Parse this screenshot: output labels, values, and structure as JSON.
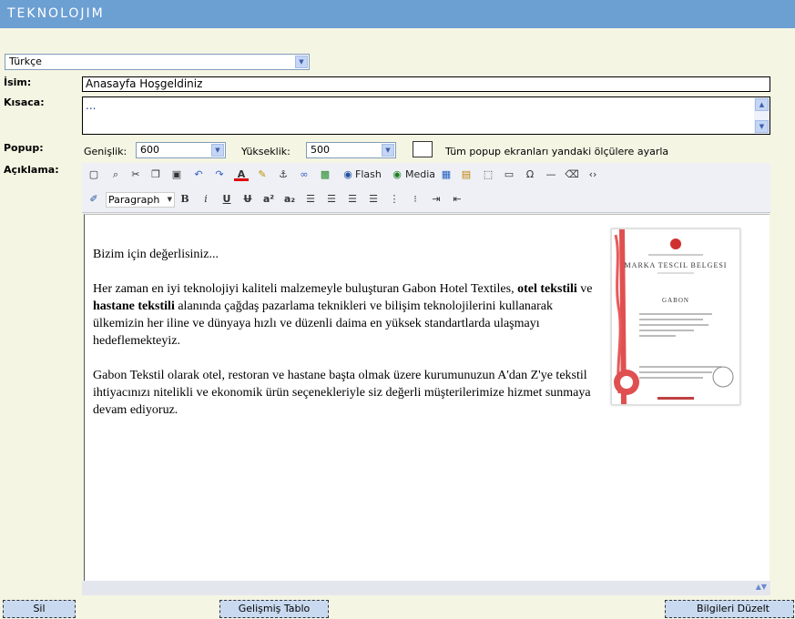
{
  "header": {
    "logo": "TEKNOLOJIM"
  },
  "language": {
    "selected": "Türkçe"
  },
  "form": {
    "name_label": "İsim:",
    "name_value": "Anasayfa Hoşgeldiniz",
    "summary_label": "Kısaca:",
    "summary_value": "...",
    "popup_label": "Popup:",
    "width_label": "Genişlik:",
    "width_value": "600",
    "height_label": "Yükseklik:",
    "height_value": "500",
    "apply_all_label": "Tüm popup ekranları yandaki ölçülere ayarla",
    "description_label": "Açıklama:"
  },
  "toolbar": {
    "flash_label": "Flash",
    "media_label": "Media",
    "format_value": "Paragraph",
    "bold": "B",
    "italic": "i",
    "underline": "U",
    "strike": "U",
    "superscript": "a²",
    "subscript": "a₂"
  },
  "content": {
    "p1": "Bizim için değerlisiniz...",
    "p2_a": "Her zaman en iyi teknolojiyi kaliteli malzemeyle buluşturan Gabon Hotel Textiles, ",
    "p2_b": "otel tekstili",
    "p2_c": " ve ",
    "p2_d": "hastane tekstili",
    "p2_e": " alanında çağdaş pazarlama teknikleri ve bilişim teknolojilerini kullanarak ülkemizin her iline ve dünyaya hızlı ve düzenli daima en yüksek standartlarda ulaşmayı hedeflemekteyiz.",
    "p3": "Gabon Tekstil olarak otel, restoran ve hastane başta olmak üzere kurumunuzun A'dan Z'ye tekstil ihtiyacınızı nitelikli ve ekonomik ürün seçenekleriyle siz değerli müşterilerimize hizmet sunmaya devam ediyoruz."
  },
  "certificate": {
    "title": "Marka Tescil Belgesi",
    "brand": "GABON"
  },
  "buttons": {
    "delete": "Sil",
    "advanced_table": "Gelişmiş Tablo",
    "update": "Bilgileri Düzelt"
  }
}
